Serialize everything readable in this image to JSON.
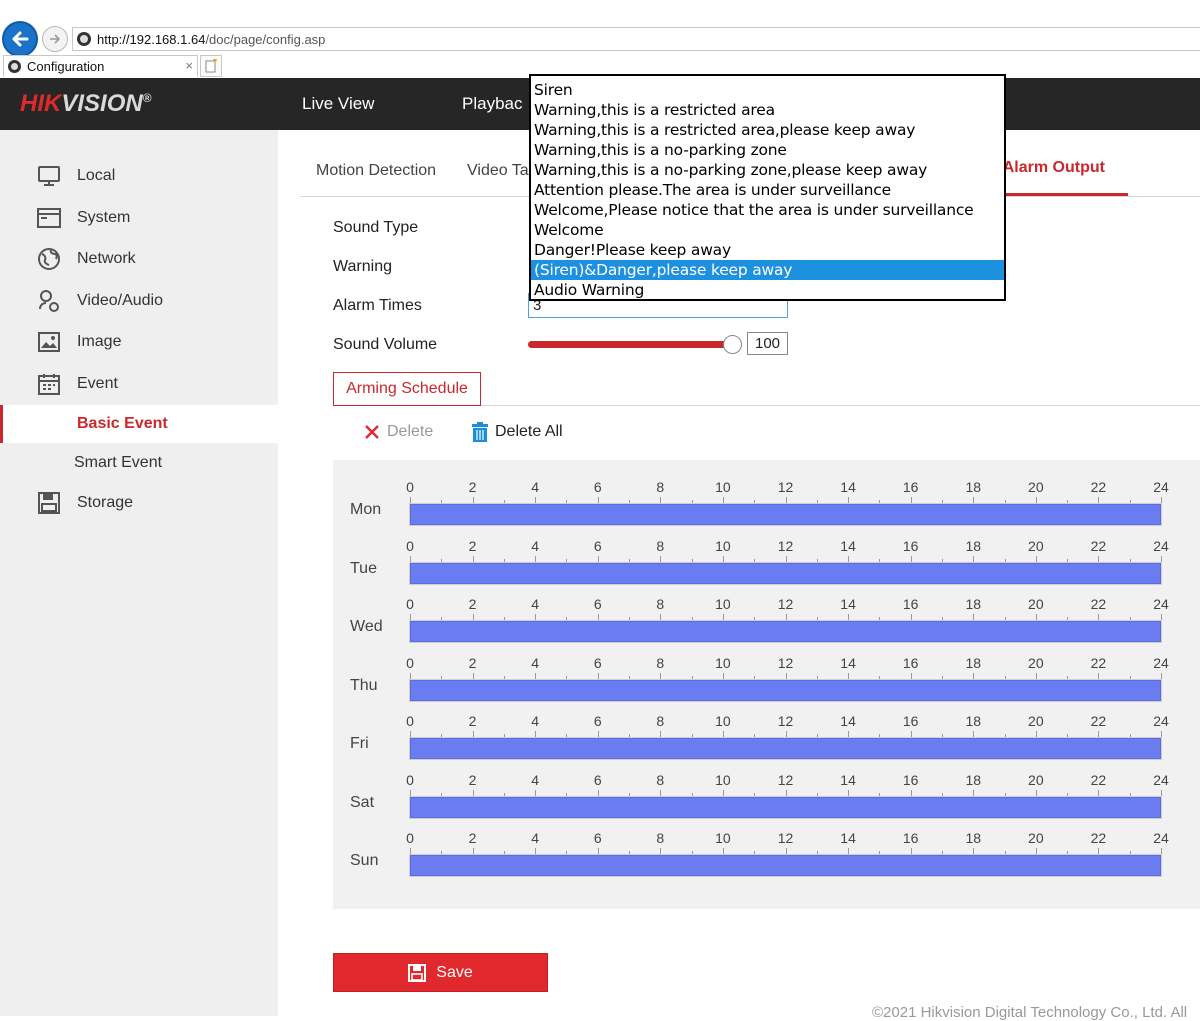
{
  "browser": {
    "url_host": "http://192.168.1.64",
    "url_path": "/doc/page/config.asp",
    "tab_title": "Configuration",
    "tab_close": "×"
  },
  "header": {
    "logo_hik": "HIK",
    "logo_vision": "VISION",
    "logo_reg": "®",
    "nav": [
      "Live View",
      "Playbac"
    ]
  },
  "sidebar": {
    "items": [
      {
        "label": "Local",
        "icon": "monitor-icon"
      },
      {
        "label": "System",
        "icon": "system-icon"
      },
      {
        "label": "Network",
        "icon": "globe-icon"
      },
      {
        "label": "Video/Audio",
        "icon": "video-audio-icon"
      },
      {
        "label": "Image",
        "icon": "image-icon"
      },
      {
        "label": "Event",
        "icon": "calendar-icon"
      }
    ],
    "sub_items": [
      {
        "label": "Basic Event",
        "active": true
      },
      {
        "label": "Smart Event",
        "active": false
      }
    ],
    "storage": {
      "label": "Storage",
      "icon": "storage-icon"
    }
  },
  "tabs": {
    "motion": "Motion Detection",
    "video_ta": "Video Ta",
    "alarm_output": "e Alarm Output"
  },
  "form": {
    "sound_type_label": "Sound Type",
    "warning_label": "Warning",
    "alarm_times_label": "Alarm Times",
    "alarm_times_value": "3",
    "sound_volume_label": "Sound Volume",
    "sound_volume_value": "100",
    "sound_volume_level": 1.0
  },
  "arming_schedule": {
    "button_label": "Arming Schedule",
    "delete_label": "Delete",
    "delete_all_label": "Delete All"
  },
  "schedule": {
    "hour_ticks": [
      "0",
      "2",
      "4",
      "6",
      "8",
      "10",
      "12",
      "14",
      "16",
      "18",
      "20",
      "22",
      "24"
    ],
    "days": [
      {
        "label": "Mon",
        "start": 0,
        "end": 24
      },
      {
        "label": "Tue",
        "start": 0,
        "end": 24
      },
      {
        "label": "Wed",
        "start": 0,
        "end": 24
      },
      {
        "label": "Thu",
        "start": 0,
        "end": 24
      },
      {
        "label": "Fri",
        "start": 0,
        "end": 24
      },
      {
        "label": "Sat",
        "start": 0,
        "end": 24
      },
      {
        "label": "Sun",
        "start": 0,
        "end": 24
      }
    ],
    "bar_color": "#6a7cf0"
  },
  "save_label": "Save",
  "footer": "©2021 Hikvision Digital Technology Co., Ltd. All",
  "warning_dropdown": {
    "options": [
      "Siren",
      "Warning,this is a restricted area",
      "Warning,this is a restricted area,please keep away",
      "Warning,this is a no-parking zone",
      "Warning,this is a no-parking zone,please keep away",
      "Attention please.The area is under surveillance",
      "Welcome,Please notice that the area is under surveillance",
      "Welcome",
      "Danger!Please keep away",
      "(Siren)&Danger,please keep away",
      "Audio Warning"
    ],
    "selected_index": 9
  },
  "colors": {
    "accent": "#c9282d",
    "header_bg": "#262626",
    "selection": "#1e90e0"
  }
}
